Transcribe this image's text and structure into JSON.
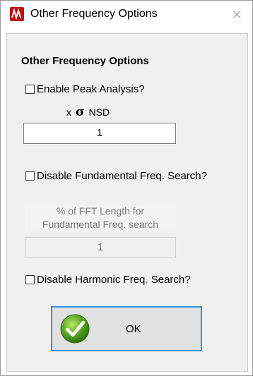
{
  "window": {
    "title": "Other Frequency Options",
    "close_glyph": "✕",
    "icon": "app-waveform-icon",
    "icon_color": "#b9141a"
  },
  "panel": {
    "heading": "Other Frequency Options",
    "enable_peak": {
      "label": "Enable Peak Analysis?",
      "checked": false
    },
    "nsd": {
      "prefix": "x",
      "sigma": "σ",
      "suffix": "NSD",
      "value": "1"
    },
    "disable_fundamental": {
      "label": "Disable Fundamental Freq. Search?",
      "checked": false
    },
    "fft_length": {
      "label_line1": "% of FFT Length for",
      "label_line2": "Fundamental Freq. search",
      "value": "1",
      "enabled": false
    },
    "disable_harmonic": {
      "label": "Disable Harmonic Freq. Search?",
      "checked": false
    }
  },
  "ok_button": {
    "label": "OK",
    "icon": "green-checkmark-icon",
    "focus_color": "#3a8fd6"
  }
}
